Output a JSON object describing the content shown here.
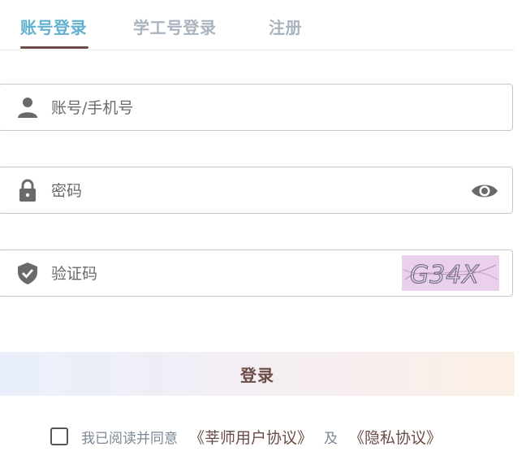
{
  "tabs": [
    {
      "label": "账号登录",
      "active": true
    },
    {
      "label": "学工号登录",
      "active": false
    },
    {
      "label": "注册",
      "active": false
    }
  ],
  "form": {
    "account": {
      "placeholder": "账号/手机号",
      "value": "",
      "icon": "user-icon"
    },
    "password": {
      "placeholder": "密码",
      "value": "",
      "icon": "lock-icon",
      "toggle_icon": "eye-icon"
    },
    "captcha": {
      "placeholder": "验证码",
      "value": "",
      "icon": "shield-check-icon",
      "image_text": "G34X"
    }
  },
  "login_button": {
    "label": "登录"
  },
  "agreement": {
    "text": "我已阅读并同意",
    "terms_link": "《莘师用户协议》",
    "and": "及",
    "privacy_link": "《隐私协议》",
    "checked": false
  },
  "colors": {
    "active_tab": "#62b1cf",
    "inactive_tab": "#a9b4be",
    "accent_brown": "#6b4c45",
    "captcha_bg": "#ead0ea"
  }
}
